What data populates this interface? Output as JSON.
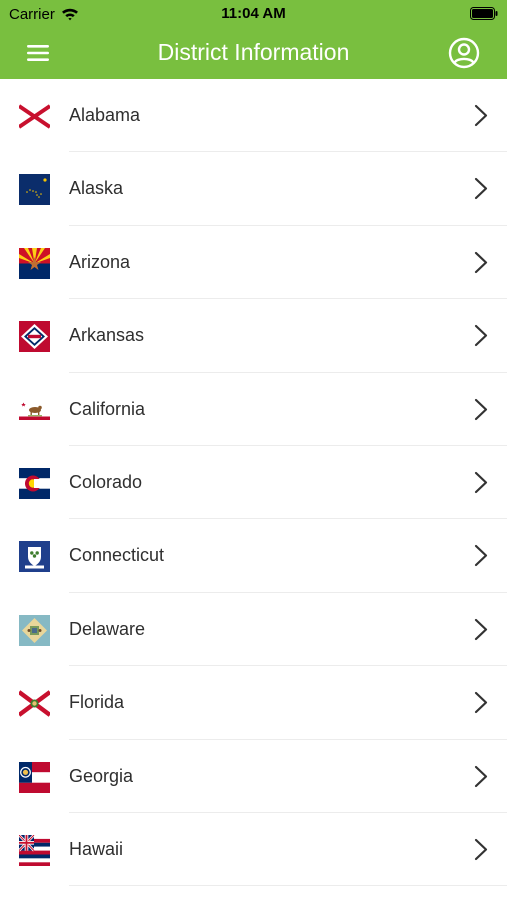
{
  "status_bar": {
    "carrier": "Carrier",
    "time": "11:04 AM",
    "wifi_icon": "wifi-icon",
    "battery_icon": "battery-icon"
  },
  "header": {
    "title": "District Information",
    "menu_icon": "menu-icon",
    "profile_icon": "profile-icon",
    "background_color": "#79bf3f"
  },
  "states": [
    {
      "name": "Alabama",
      "flag_icon": "alabama-flag-icon"
    },
    {
      "name": "Alaska",
      "flag_icon": "alaska-flag-icon"
    },
    {
      "name": "Arizona",
      "flag_icon": "arizona-flag-icon"
    },
    {
      "name": "Arkansas",
      "flag_icon": "arkansas-flag-icon"
    },
    {
      "name": "California",
      "flag_icon": "california-flag-icon"
    },
    {
      "name": "Colorado",
      "flag_icon": "colorado-flag-icon"
    },
    {
      "name": "Connecticut",
      "flag_icon": "connecticut-flag-icon"
    },
    {
      "name": "Delaware",
      "flag_icon": "delaware-flag-icon"
    },
    {
      "name": "Florida",
      "flag_icon": "florida-flag-icon"
    },
    {
      "name": "Georgia",
      "flag_icon": "georgia-flag-icon"
    },
    {
      "name": "Hawaii",
      "flag_icon": "hawaii-flag-icon"
    }
  ]
}
